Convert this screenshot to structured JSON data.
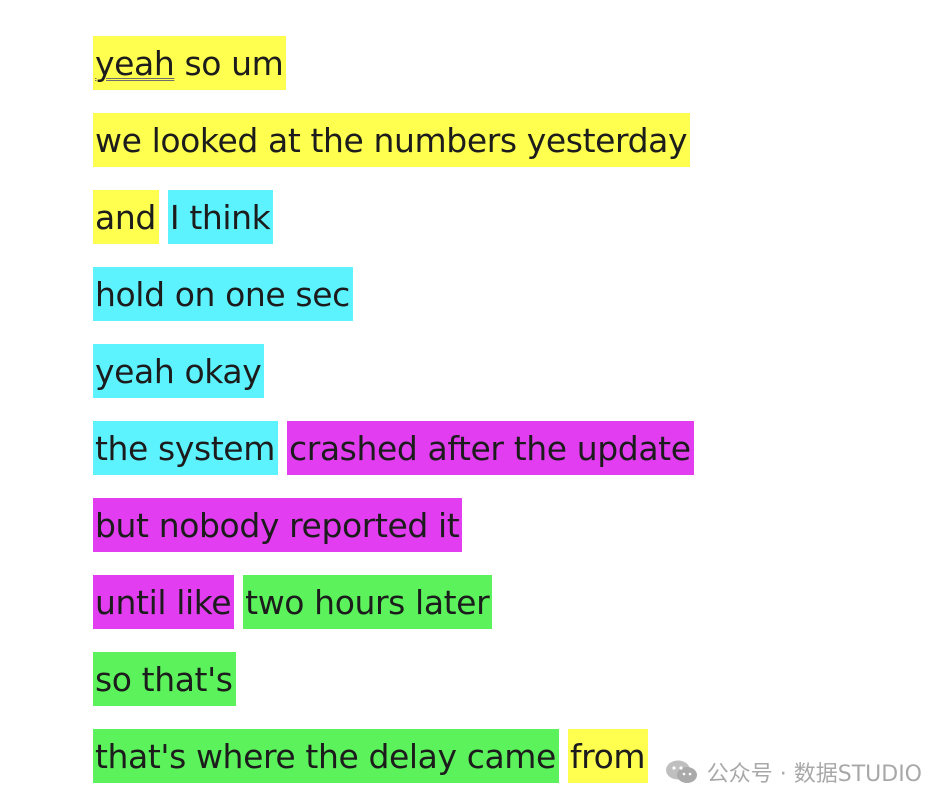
{
  "colors": {
    "yellow": "#ffff4f",
    "cyan": "#5cf3ff",
    "magenta": "#e23df1",
    "green": "#5bf25b"
  },
  "lines": [
    [
      {
        "parts": [
          {
            "text": "yeah",
            "spell": true
          },
          {
            "text": " so um"
          }
        ],
        "color": "yellow"
      }
    ],
    [
      {
        "text": "we looked at the numbers yesterday",
        "color": "yellow"
      }
    ],
    [
      {
        "text": "and",
        "color": "yellow"
      },
      {
        "text": "I think",
        "color": "cyan"
      }
    ],
    [
      {
        "text": "hold on one sec",
        "color": "cyan"
      }
    ],
    [
      {
        "text": "yeah okay",
        "color": "cyan"
      }
    ],
    [
      {
        "text": "the system",
        "color": "cyan"
      },
      {
        "text": "crashed after the update",
        "color": "magenta"
      }
    ],
    [
      {
        "text": "but nobody reported it",
        "color": "magenta"
      }
    ],
    [
      {
        "text": "until like",
        "color": "magenta"
      },
      {
        "text": "two hours later",
        "color": "green"
      }
    ],
    [
      {
        "text": "so that's",
        "color": "green"
      }
    ],
    [
      {
        "text": "that's where the delay came",
        "color": "green"
      },
      {
        "text": "from",
        "color": "yellow"
      }
    ]
  ],
  "watermark": {
    "icon": "wechat-icon",
    "text": "公众号 · 数据STUDIO"
  }
}
